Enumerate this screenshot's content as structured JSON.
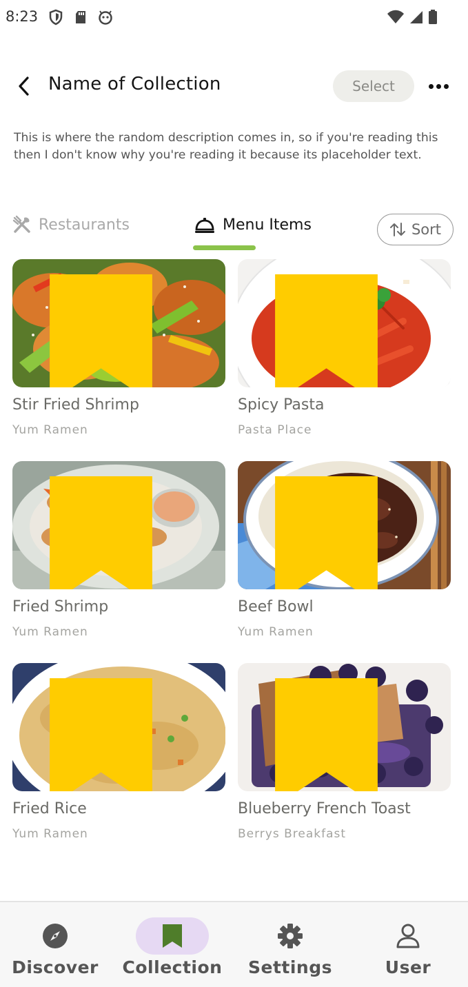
{
  "status_bar": {
    "time": "8:23",
    "left_icons": [
      "shield-icon",
      "sd-card-icon",
      "android-face-icon"
    ],
    "right_icons": [
      "wifi-icon",
      "cellular-signal-icon",
      "battery-icon"
    ]
  },
  "header": {
    "title": "Name of Collection",
    "select_label": "Select",
    "back_icon": "chevron-left-icon",
    "more_icon": "more-horizontal-icon"
  },
  "description": "This is where the random description comes in, so if you're reading this then I don't know why you're reading it because its placeholder text.",
  "tabs": {
    "items": [
      {
        "label": "Restaurants",
        "icon": "utensils-crossed-icon",
        "active": false
      },
      {
        "label": "Menu Items",
        "icon": "cloche-icon",
        "active": true
      }
    ],
    "sort_label": "Sort",
    "sort_icon": "sort-arrows-icon"
  },
  "cards": [
    {
      "title": "Stir Fried Shrimp",
      "subtitle": "Yum Ramen",
      "image": "stir-fried-shrimp-photo",
      "bookmarked": true
    },
    {
      "title": "Spicy Pasta",
      "subtitle": "Pasta Place",
      "image": "spicy-pasta-photo",
      "bookmarked": true
    },
    {
      "title": "Fried Shrimp",
      "subtitle": "Yum Ramen",
      "image": "fried-shrimp-photo",
      "bookmarked": true
    },
    {
      "title": "Beef Bowl",
      "subtitle": "Yum Ramen",
      "image": "beef-bowl-photo",
      "bookmarked": true
    },
    {
      "title": "Fried Rice",
      "subtitle": "Yum Ramen",
      "image": "fried-rice-photo",
      "bookmarked": true
    },
    {
      "title": "Blueberry French Toast",
      "subtitle": "Berrys Breakfast",
      "image": "blueberry-french-toast-photo",
      "bookmarked": true
    }
  ],
  "bottom_nav": {
    "items": [
      {
        "label": "Discover",
        "icon": "compass-icon",
        "active": false
      },
      {
        "label": "Collection",
        "icon": "bookmark-icon",
        "active": true
      },
      {
        "label": "Settings",
        "icon": "gear-icon",
        "active": false
      },
      {
        "label": "User",
        "icon": "user-icon",
        "active": false
      }
    ]
  },
  "colors": {
    "accent_green": "#8bc34a",
    "bookmark_yellow": "#ffcc00",
    "active_nav_pill": "#e6d9f3",
    "collection_icon_green": "#4f7d2a"
  }
}
